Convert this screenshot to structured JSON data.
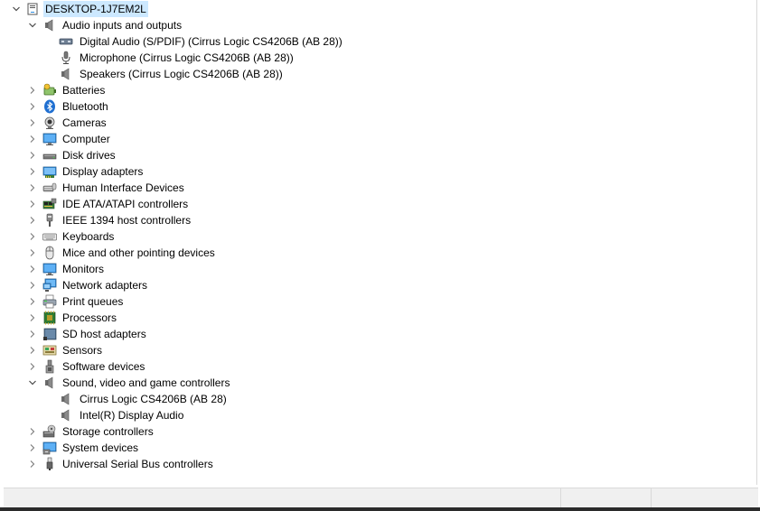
{
  "tree": {
    "root": {
      "label": "DESKTOP-1J7EM2L",
      "icon": "computer-icon",
      "expanded": true
    },
    "items": [
      {
        "label": "Audio inputs and outputs",
        "icon": "speaker-icon",
        "expanded": true,
        "children": [
          {
            "label": "Digital Audio (S/PDIF) (Cirrus Logic CS4206B (AB 28))",
            "icon": "digital-audio-icon"
          },
          {
            "label": "Microphone (Cirrus Logic CS4206B (AB 28))",
            "icon": "microphone-icon"
          },
          {
            "label": "Speakers (Cirrus Logic CS4206B (AB 28))",
            "icon": "speaker-icon"
          }
        ]
      },
      {
        "label": "Batteries",
        "icon": "battery-icon",
        "expanded": false
      },
      {
        "label": "Bluetooth",
        "icon": "bluetooth-icon",
        "expanded": false
      },
      {
        "label": "Cameras",
        "icon": "camera-icon",
        "expanded": false
      },
      {
        "label": "Computer",
        "icon": "monitor-icon",
        "expanded": false
      },
      {
        "label": "Disk drives",
        "icon": "disk-drive-icon",
        "expanded": false
      },
      {
        "label": "Display adapters",
        "icon": "display-adapter-icon",
        "expanded": false
      },
      {
        "label": "Human Interface Devices",
        "icon": "hid-icon",
        "expanded": false
      },
      {
        "label": "IDE ATA/ATAPI controllers",
        "icon": "ide-controller-icon",
        "expanded": false
      },
      {
        "label": "IEEE 1394 host controllers",
        "icon": "firewire-icon",
        "expanded": false
      },
      {
        "label": "Keyboards",
        "icon": "keyboard-icon",
        "expanded": false
      },
      {
        "label": "Mice and other pointing devices",
        "icon": "mouse-icon",
        "expanded": false
      },
      {
        "label": "Monitors",
        "icon": "monitor-icon",
        "expanded": false
      },
      {
        "label": "Network adapters",
        "icon": "network-adapter-icon",
        "expanded": false
      },
      {
        "label": "Print queues",
        "icon": "printer-icon",
        "expanded": false
      },
      {
        "label": "Processors",
        "icon": "processor-icon",
        "expanded": false
      },
      {
        "label": "SD host adapters",
        "icon": "sd-card-icon",
        "expanded": false
      },
      {
        "label": "Sensors",
        "icon": "sensor-icon",
        "expanded": false
      },
      {
        "label": "Software devices",
        "icon": "software-device-icon",
        "expanded": false
      },
      {
        "label": "Sound, video and game controllers",
        "icon": "speaker-icon",
        "expanded": true,
        "children": [
          {
            "label": "Cirrus Logic CS4206B (AB 28)",
            "icon": "speaker-icon"
          },
          {
            "label": "Intel(R) Display Audio",
            "icon": "speaker-icon"
          }
        ]
      },
      {
        "label": "Storage controllers",
        "icon": "storage-controller-icon",
        "expanded": false
      },
      {
        "label": "System devices",
        "icon": "system-devices-icon",
        "expanded": false
      },
      {
        "label": "Universal Serial Bus controllers",
        "icon": "usb-icon",
        "expanded": false
      }
    ]
  },
  "colors": {
    "selection": "#cce8ff",
    "chevron": "#4a4a4a",
    "statusbar": "#f0f0f0"
  }
}
